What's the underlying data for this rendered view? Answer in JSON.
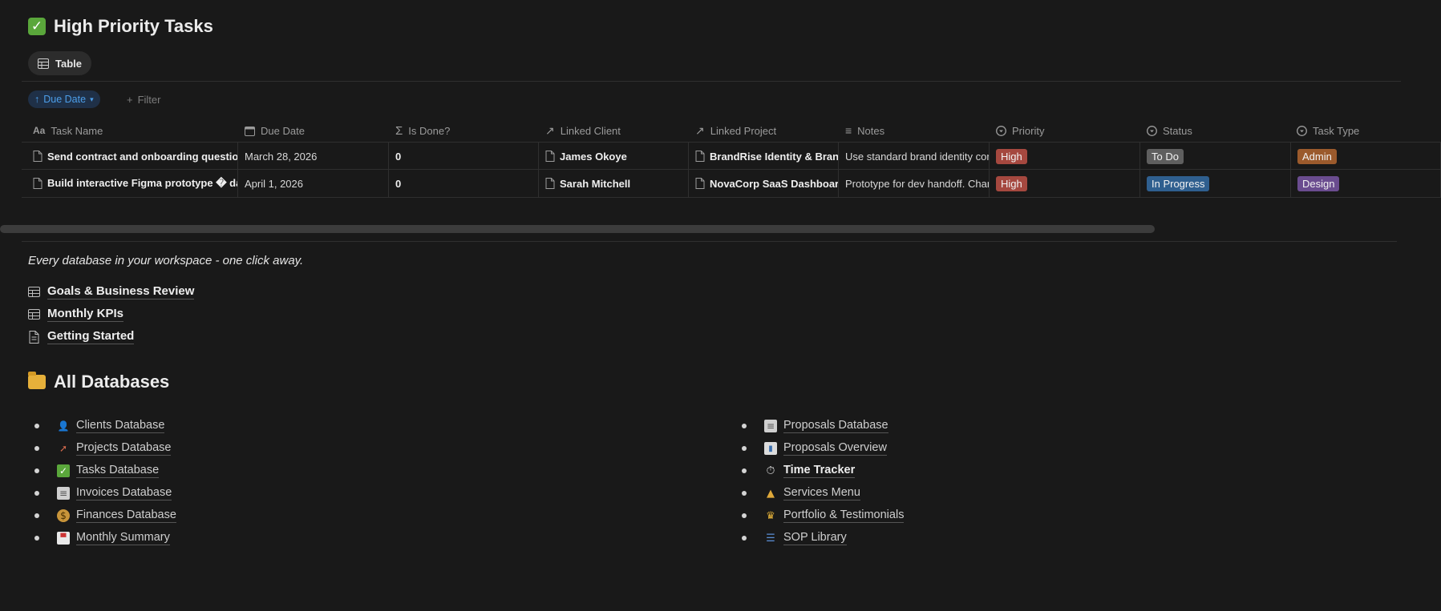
{
  "page": {
    "title": "High Priority Tasks",
    "view_tab": "Table",
    "sort_label": "Due Date",
    "filter_label": "Filter"
  },
  "table": {
    "columns": [
      "Task Name",
      "Due Date",
      "Is Done?",
      "Linked Client",
      "Linked Project",
      "Notes",
      "Priority",
      "Status",
      "Task Type"
    ],
    "rows": [
      {
        "task": "Send contract and onboarding questionnaire",
        "due": "March 28, 2026",
        "done": "0",
        "client": "James Okoye",
        "project": "BrandRise Identity & Brand",
        "notes": "Use standard brand identity contract",
        "priority": "High",
        "status": "To Do",
        "type": "Admin"
      },
      {
        "task": "Build interactive Figma prototype � dashboard",
        "due": "April 1, 2026",
        "done": "0",
        "client": "Sarah Mitchell",
        "project": "NovaCorp SaaS Dashboard",
        "notes": "Prototype for dev handoff. Changes",
        "priority": "High",
        "status": "In Progress",
        "type": "Design"
      }
    ]
  },
  "colors": {
    "priority_high": "#a5483f",
    "status_todo": "#5f5f5f",
    "status_inprogress": "#2f5f8f",
    "type_admin": "#9b5a2c",
    "type_design": "#6a4c8f"
  },
  "tagline": "Every database in your workspace - one click away.",
  "quick_links": [
    {
      "label": "Goals & Business Review",
      "icon": "table-icon"
    },
    {
      "label": "Monthly KPIs",
      "icon": "table-icon"
    },
    {
      "label": "Getting Started",
      "icon": "page-icon"
    }
  ],
  "all_databases": {
    "heading": "All Databases",
    "left": [
      {
        "label": "Clients Database",
        "icon": "person-icon"
      },
      {
        "label": "Projects Database",
        "icon": "rocket-icon"
      },
      {
        "label": "Tasks Database",
        "icon": "check-icon"
      },
      {
        "label": "Invoices Database",
        "icon": "receipt-icon"
      },
      {
        "label": "Finances Database",
        "icon": "money-bag-icon"
      },
      {
        "label": "Monthly Summary",
        "icon": "calendar-icon"
      }
    ],
    "right": [
      {
        "label": "Proposals Database",
        "icon": "clipboard-icon"
      },
      {
        "label": "Proposals Overview",
        "icon": "bar-chart-icon"
      },
      {
        "label": "Time Tracker",
        "icon": "stopwatch-icon"
      },
      {
        "label": "Services Menu",
        "icon": "bell-icon"
      },
      {
        "label": "Portfolio & Testimonials",
        "icon": "trophy-icon"
      },
      {
        "label": "SOP Library",
        "icon": "books-icon"
      }
    ]
  }
}
